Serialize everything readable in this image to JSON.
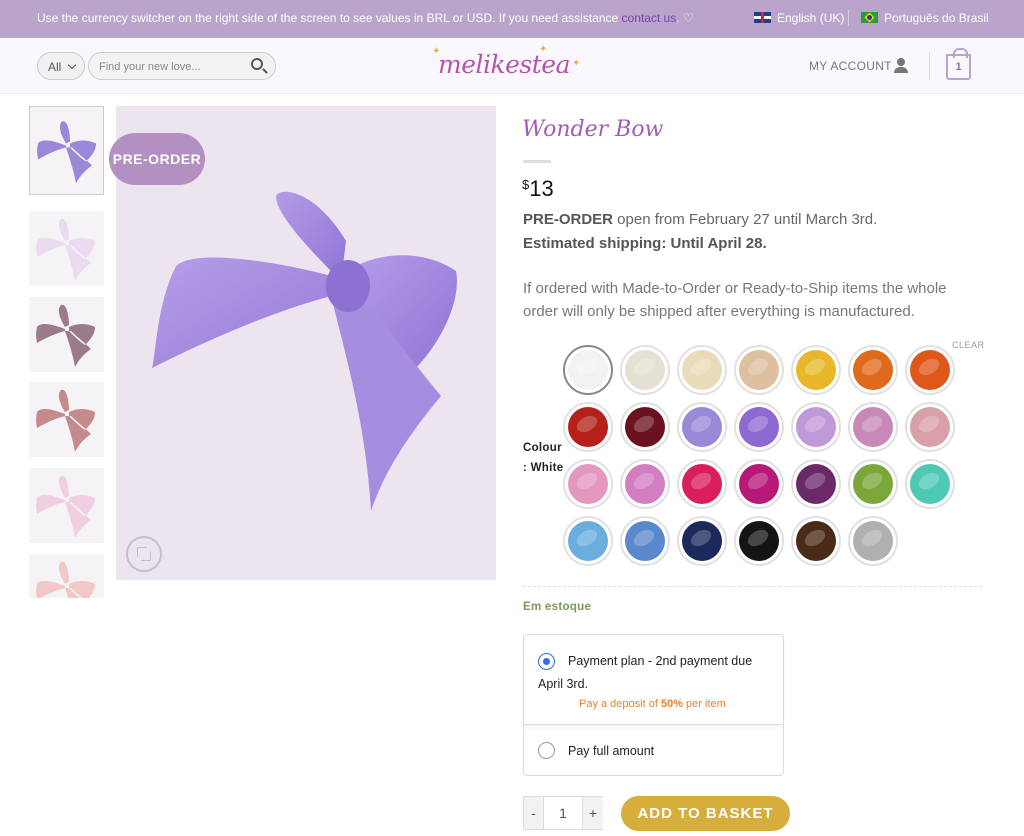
{
  "topbar": {
    "message": "Use the currency switcher on the right side of the screen to see values in BRL or USD. If you need assistance ",
    "contact_link": "contact us",
    "message_suffix": ". ♡",
    "lang_en": "English (UK)",
    "lang_pt": "Português do Brasil"
  },
  "header": {
    "category": "All",
    "search_placeholder": "Find your new love...",
    "logo": "melikestea",
    "account": "MY ACCOUNT",
    "cart_count": "1"
  },
  "gallery": {
    "badge": "PRE-ORDER",
    "thumb_colors": [
      "#9c86d8",
      "#eadbf0",
      "#9a7b8c",
      "#c48a8c",
      "#f1cfe2",
      "#f2c7c7"
    ]
  },
  "product": {
    "title": "Wonder Bow",
    "currency": "$",
    "price": "13",
    "preorder_label": "PRE-ORDER",
    "preorder_text": " open from February 27 until March 3rd.",
    "shipping": "Estimated shipping: Until April 28.",
    "note": "If ordered with Made-to-Order or Ready-to-Ship items  the whole order will only be shipped after everything is manufactured.",
    "clear": "CLEAR",
    "colour_label": "Colour",
    "colour_value": ": White",
    "swatches": [
      "#f2f2f2",
      "#e4e0d2",
      "#e9dcb8",
      "#dcc0a0",
      "#e8b82a",
      "#e06a1c",
      "#e0571a",
      "#b5201a",
      "#6a1220",
      "#9a88d8",
      "#8d6ad2",
      "#c09ad8",
      "#c689b8",
      "#d8a0a8",
      "#e497bf",
      "#d37dc2",
      "#d81e5c",
      "#b81878",
      "#6a2a6a",
      "#7ba63a",
      "#4fc9b6",
      "#6aaee0",
      "#5a88cc",
      "#1b2a5a",
      "#141414",
      "#4a2a18",
      "#b0b0b0"
    ],
    "stock": "Em estoque",
    "payment_plan_line1": "Payment plan - 2nd payment due",
    "payment_plan_line2": "April 3rd.",
    "deposit_prefix": "Pay a deposit of ",
    "deposit_value": "50%",
    "deposit_suffix": " per item",
    "pay_full": "Pay full amount",
    "qty_minus": "-",
    "qty_value": "1",
    "qty_plus": "+",
    "add_to_basket": "ADD TO BASKET"
  }
}
